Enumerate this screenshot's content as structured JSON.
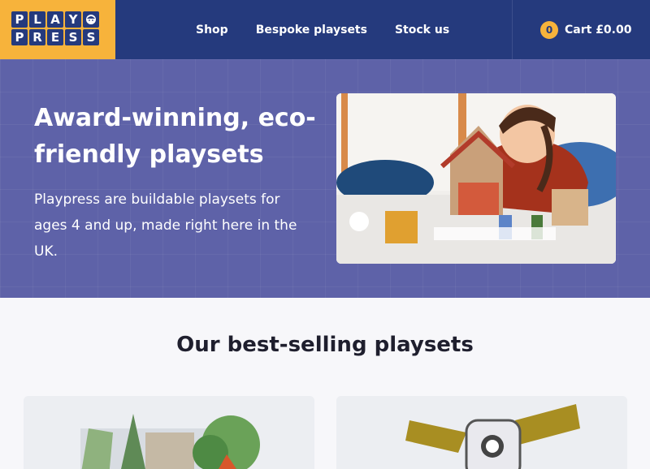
{
  "brand": {
    "logo_row1": [
      "P",
      "L",
      "A",
      "Y"
    ],
    "logo_row2": [
      "P",
      "R",
      "E",
      "S",
      "S"
    ],
    "logo_colors": {
      "bg": "#f7b33b",
      "tile": "#253a7d"
    }
  },
  "nav": {
    "items": [
      {
        "label": "Shop"
      },
      {
        "label": "Bespoke playsets"
      },
      {
        "label": "Stock us"
      }
    ]
  },
  "cart": {
    "count": "0",
    "label": "Cart £0.00"
  },
  "hero": {
    "title": "Award-winning, eco-friendly playsets",
    "text": "Playpress are buildable playsets for ages 4 and up, made right here in the UK.",
    "image_icon": "child-playing-photo"
  },
  "bestsellers": {
    "title": "Our best-selling playsets",
    "cards": [
      {
        "icon": "forest-playset-photo"
      },
      {
        "icon": "space-satellite-playset-photo"
      }
    ]
  },
  "colors": {
    "header": "#253a7d",
    "accent": "#f7b33b",
    "hero": "#5e62a8"
  }
}
